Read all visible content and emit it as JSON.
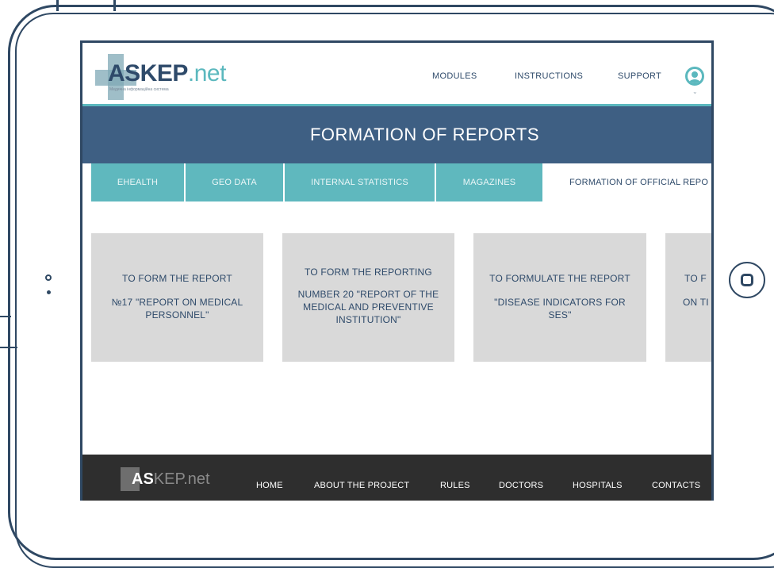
{
  "header": {
    "logo_main": "ASKEP",
    "logo_net": ".net",
    "logo_tagline": "Медична інформаційна система",
    "nav": [
      "MODULES",
      "INSTRUCTIONS",
      "SUPPORT"
    ]
  },
  "page_title": "FORMATION OF REPORTS",
  "tabs": [
    {
      "label": "EHEALTH",
      "active": false
    },
    {
      "label": "GEO DATA",
      "active": false
    },
    {
      "label": "INTERNAL STATISTICS",
      "active": false
    },
    {
      "label": "MAGAZINES",
      "active": false
    },
    {
      "label": "FORMATION OF OFFICIAL REPO",
      "active": true
    }
  ],
  "cards": [
    {
      "line1": "TO FORM THE REPORT",
      "line2": "№17 \"REPORT ON MEDICAL PERSONNEL\""
    },
    {
      "line1": "TO FORM THE REPORTING",
      "line2": "NUMBER 20 \"REPORT OF THE MEDICAL AND PREVENTIVE INSTITUTION\""
    },
    {
      "line1": "TO FORMULATE THE REPORT",
      "line2": "\"DISEASE INDICATORS FOR SES\""
    },
    {
      "line1": "TO F",
      "line2": "ON TI"
    }
  ],
  "footer": {
    "logo_main": "AS",
    "logo_mid": "KEP",
    "logo_net": ".net",
    "nav": [
      "HOME",
      "ABOUT THE PROJECT",
      "RULES",
      "DOCTORS",
      "HOSPITALS",
      "CONTACTS"
    ]
  },
  "colors": {
    "navy": "#3e5f83",
    "teal": "#5fb8be",
    "frame": "#2f4863",
    "card": "#d9d9d9",
    "footer": "#2e2e2e"
  }
}
